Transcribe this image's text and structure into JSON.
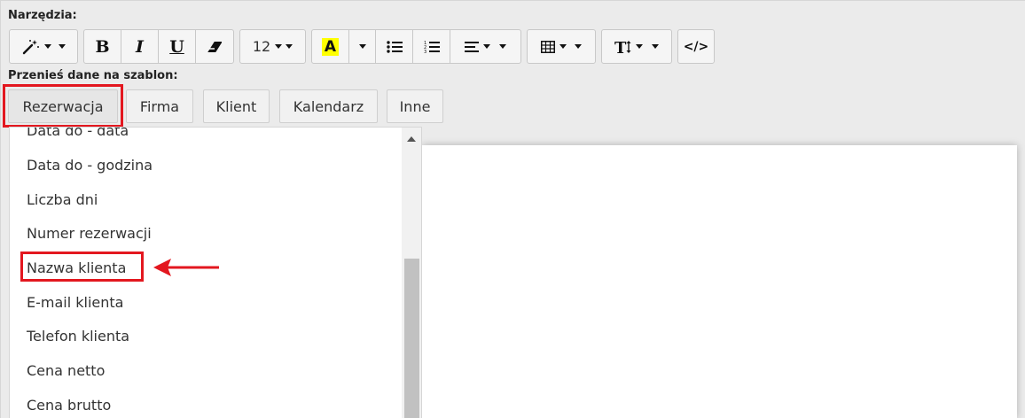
{
  "toolbar": {
    "label": "Narzędzia:",
    "font_size": "12",
    "code_label": "</>"
  },
  "buttons": {
    "bold": "B",
    "italic": "I",
    "underline": "U",
    "highlight": "A"
  },
  "transfer": {
    "label": "Przenieś dane na szablon:",
    "tabs": [
      "Rezerwacja",
      "Firma",
      "Klient",
      "Kalendarz",
      "Inne"
    ]
  },
  "dropdown": {
    "items": [
      "Data do - data",
      "Data do - godzina",
      "Liczba dni",
      "Numer rezerwacji",
      "Nazwa klienta",
      "E-mail klienta",
      "Telefon klienta",
      "Cena netto",
      "Cena brutto"
    ]
  },
  "colors": {
    "highlight": "#e3171f",
    "text_highlight": "#ffff00"
  }
}
